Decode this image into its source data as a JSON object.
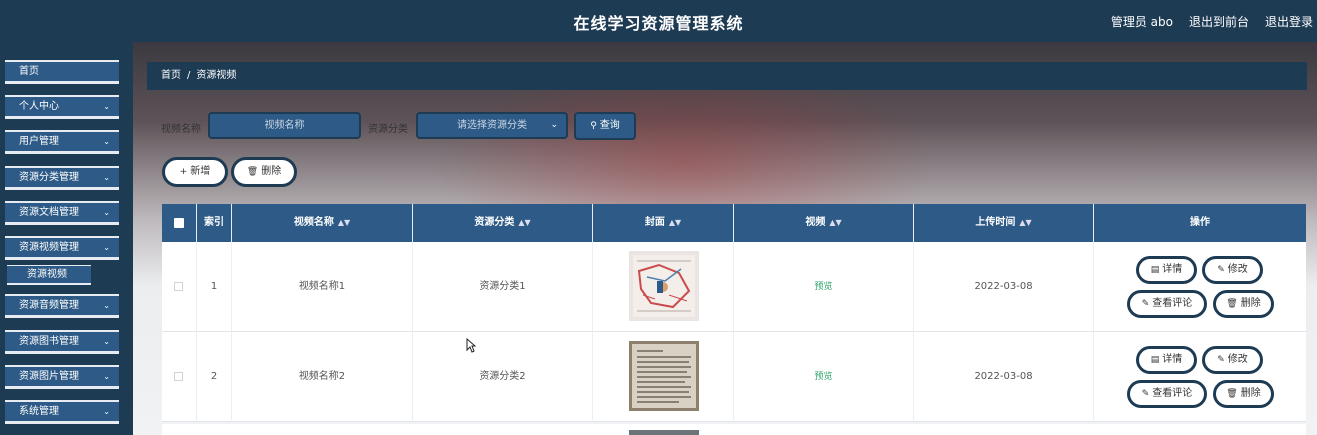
{
  "header": {
    "title": "在线学习资源管理系统",
    "admin": "管理员 abo",
    "to_front": "退出到前台",
    "logout": "退出登录"
  },
  "sidebar": {
    "items": [
      {
        "label": "首页",
        "has_chevron": false
      },
      {
        "label": "个人中心",
        "has_chevron": true
      },
      {
        "label": "用户管理",
        "has_chevron": true
      },
      {
        "label": "资源分类管理",
        "has_chevron": true
      },
      {
        "label": "资源文档管理",
        "has_chevron": true
      },
      {
        "label": "资源视频管理",
        "has_chevron": true
      },
      {
        "label": "资源音频管理",
        "has_chevron": true
      },
      {
        "label": "资源图书管理",
        "has_chevron": true
      },
      {
        "label": "资源图片管理",
        "has_chevron": true
      },
      {
        "label": "系统管理",
        "has_chevron": true
      }
    ],
    "subitem": "资源视频"
  },
  "breadcrumb": {
    "home": "首页",
    "separator": "/",
    "current": "资源视频"
  },
  "search": {
    "name_label": "视频名称",
    "name_placeholder": "视频名称",
    "category_label": "资源分类",
    "category_placeholder": "请选择资源分类",
    "query_button": "查询"
  },
  "actions": {
    "add": "新增",
    "delete": "删除"
  },
  "table": {
    "columns": [
      "索引",
      "视频名称",
      "资源分类",
      "封面",
      "视频",
      "上传时间",
      "操作"
    ],
    "rows": [
      {
        "index": "1",
        "name": "视频名称1",
        "category": "资源分类1",
        "video": "预览",
        "uploaded": "2022-03-08"
      },
      {
        "index": "2",
        "name": "视频名称2",
        "category": "资源分类2",
        "video": "预览",
        "uploaded": "2022-03-08"
      }
    ],
    "row_actions": {
      "detail": "详情",
      "edit": "修改",
      "comments": "查看评论",
      "delete": "删除"
    }
  },
  "colors": {
    "primary_dark": "#1e3b54",
    "primary": "#2d5a86",
    "preview_link": "#2fa36b"
  },
  "icons": {
    "chevron": "chevron-down-icon",
    "search": "search-icon",
    "plus": "plus-icon",
    "trash": "trash-icon",
    "doc": "document-icon",
    "pencil": "pencil-icon",
    "sort": "sort-icon"
  }
}
